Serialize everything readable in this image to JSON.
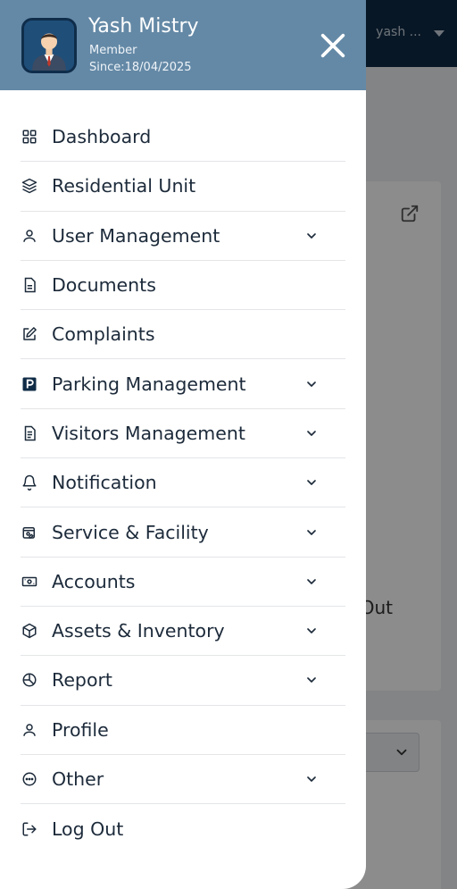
{
  "background": {
    "user_short": "yash ...",
    "card_text": "Out"
  },
  "drawer": {
    "user": {
      "name": "Yash Mistry",
      "role": "Member",
      "since": "Since:18/04/2025"
    },
    "menu": [
      {
        "label": "Dashboard",
        "icon": "grid-icon",
        "expandable": false
      },
      {
        "label": "Residential Unit",
        "icon": "layers-icon",
        "expandable": false
      },
      {
        "label": "User Management",
        "icon": "user-icon",
        "expandable": true
      },
      {
        "label": "Documents",
        "icon": "document-icon",
        "expandable": false
      },
      {
        "label": "Complaints",
        "icon": "edit-icon",
        "expandable": false
      },
      {
        "label": "Parking Management",
        "icon": "parking-icon",
        "expandable": true
      },
      {
        "label": "Visitors Management",
        "icon": "file-text-icon",
        "expandable": true
      },
      {
        "label": "Notification",
        "icon": "bell-icon",
        "expandable": true
      },
      {
        "label": "Service & Facility",
        "icon": "service-icon",
        "expandable": true
      },
      {
        "label": "Accounts",
        "icon": "money-icon",
        "expandable": true
      },
      {
        "label": "Assets & Inventory",
        "icon": "box-icon",
        "expandable": true
      },
      {
        "label": "Report",
        "icon": "pie-chart-icon",
        "expandable": true
      },
      {
        "label": "Profile",
        "icon": "user-icon",
        "expandable": false
      },
      {
        "label": "Other",
        "icon": "more-circle-icon",
        "expandable": true
      },
      {
        "label": "Log Out",
        "icon": "logout-icon",
        "expandable": false
      }
    ]
  },
  "colors": {
    "header_bg": "#6489a6",
    "topbar_bg": "#0f2b46",
    "text": "#1c2a3a"
  }
}
